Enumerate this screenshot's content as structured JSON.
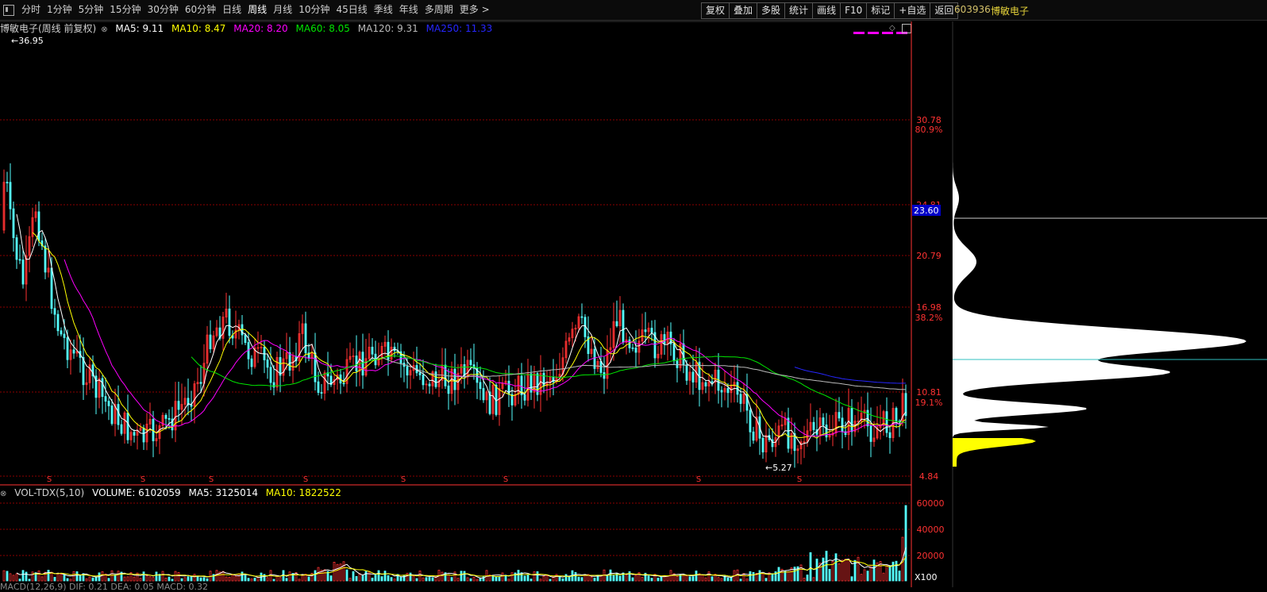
{
  "toolbar": {
    "menu_icon": "menu-icon",
    "periods": [
      "分时",
      "1分钟",
      "5分钟",
      "15分钟",
      "30分钟",
      "60分钟",
      "日线",
      "周线",
      "月线",
      "10分钟",
      "45日线",
      "季线",
      "年线",
      "多周期",
      "更多 >"
    ],
    "active_period": "周线",
    "right_buttons": [
      "复权",
      "叠加",
      "多股",
      "统计",
      "画线",
      "F10",
      "标记",
      "+自选",
      "返回"
    ]
  },
  "stock": {
    "code": "603936",
    "name": "博敏电子"
  },
  "ma_info": {
    "title": "博敏电子(周线 前复权)",
    "ma5": "MA5: 9.11",
    "ma10": "MA10: 8.47",
    "ma20": "MA20: 8.20",
    "ma60": "MA60: 8.05",
    "ma120": "MA120: 9.31",
    "ma250": "MA250: 11.33"
  },
  "colors": {
    "up": "#ff3232",
    "down": "#54ffff",
    "ma5": "#ffffff",
    "ma10": "#ffff00",
    "ma20": "#ff00ff",
    "ma60": "#00e600",
    "ma120": "#bbbbbb",
    "ma250": "#2626ff",
    "grid": "#8b0000",
    "axis": "#ff3232",
    "profile": "#ffffff",
    "profile_low": "#ffff00"
  },
  "price_axis": {
    "labels": [
      "30.78",
      "24.81",
      "20.79",
      "16.98",
      "10.81",
      "4.84"
    ],
    "pct_labels": [
      "80.9%",
      "38.2%",
      "19.1%"
    ],
    "current_price": "23.60",
    "max_label": "36.95",
    "min_label": "5.27"
  },
  "volume_info": {
    "title": "VOL-TDX(5,10)",
    "volume": "VOLUME: 6102059",
    "ma5": "MA5: 3125014",
    "ma10": "MA10: 1822522",
    "axis_labels": [
      "60000",
      "40000",
      "20000"
    ],
    "unit": "X100"
  },
  "macd_info": {
    "text": "MACD(12,26,9) DIF: 0.21 DEA: 0.05 MACD: 0.32"
  },
  "markers": {
    "symbol": "S",
    "count": 8
  }
}
